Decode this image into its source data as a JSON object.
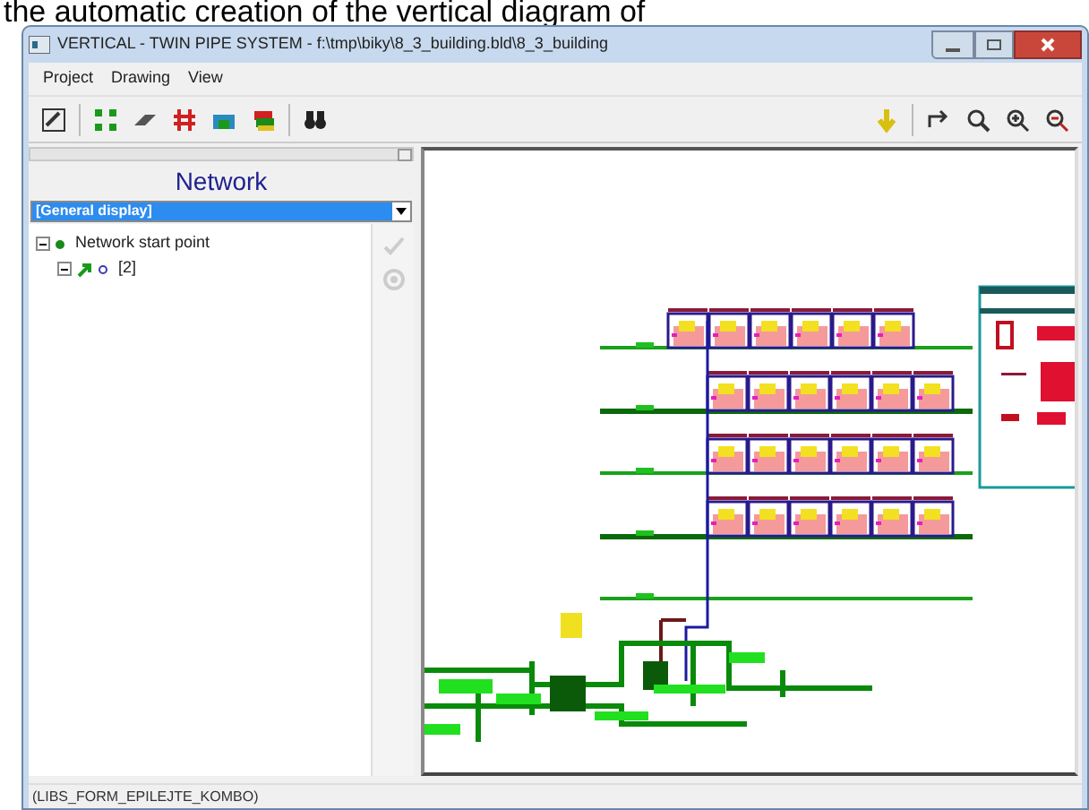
{
  "caption": "the automatic creation of the vertical diagram of",
  "window": {
    "title": "VERTICAL - TWIN PIPE SYSTEM - f:\\tmp\\biky\\8_3_building.bld\\8_3_building"
  },
  "menu": [
    {
      "label": "Project"
    },
    {
      "label": "Drawing"
    },
    {
      "label": "View"
    }
  ],
  "panel": {
    "title": "Network",
    "dropdown": {
      "value": "[General display]"
    },
    "tree": [
      {
        "label": "Network start point",
        "expanded": true,
        "children": [
          {
            "label": "[2]",
            "expanded": true
          }
        ]
      }
    ]
  },
  "status_bar": "(LIBS_FORM_EPILEJTE_KOMBO)"
}
